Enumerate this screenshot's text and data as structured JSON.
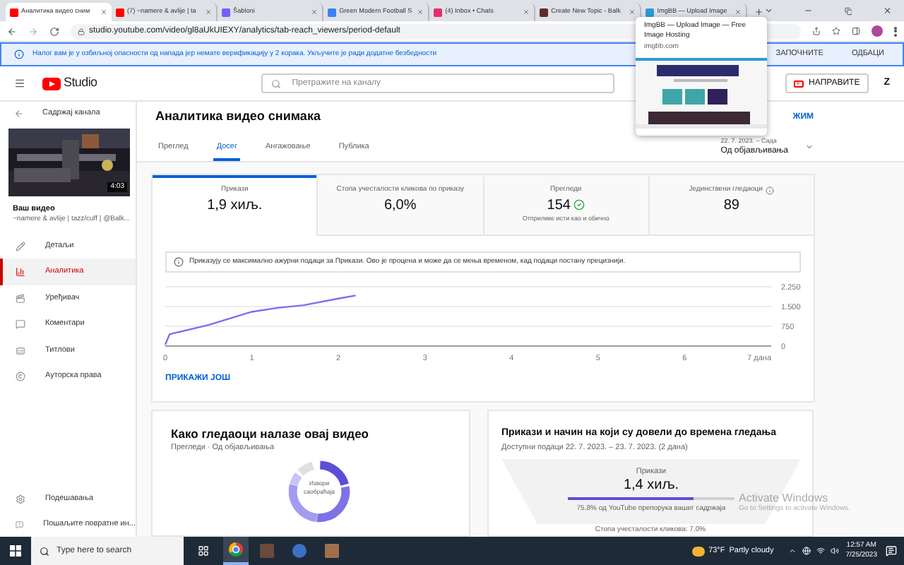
{
  "browser": {
    "tabs": [
      {
        "title": "Аналитика видео сним",
        "selected": true
      },
      {
        "title": "(7) ~namere & avlije | ta",
        "selected": false
      },
      {
        "title": "Šabloni",
        "selected": false
      },
      {
        "title": "Green Modern Football S",
        "selected": false
      },
      {
        "title": "(4) Inbox • Chats",
        "selected": false
      },
      {
        "title": "Create New Topic - Balk",
        "selected": false
      },
      {
        "title": "ImgBB — Upload Image",
        "selected": false
      }
    ],
    "url": "studio.youtube.com/video/gl8aUkUIEXY/analytics/tab-reach_viewers/period-default"
  },
  "tab_preview": {
    "title": "ImgBB — Upload Image — Free Image Hosting",
    "domain": "imgbb.com"
  },
  "banner": {
    "message": "Налог вам је у озбиљној опасности од напада јер немате верификацију у 2 корака. Укључите је ради додатне безбедности",
    "buttons": [
      "ЗАПОЧНИТЕ",
      "ОДБАЦИ"
    ]
  },
  "header": {
    "logo": "Studio",
    "search_placeholder": "Претражите на каналу",
    "create_button": "НАПРАВИТЕ",
    "avatar": "Z"
  },
  "sidebar": {
    "back_label": "Садржај канала",
    "video_duration": "4:03",
    "video_label": "Ваш видео",
    "video_name": "~namere & avlije | tazz/cuff | @Balk...",
    "items": [
      {
        "label": "Детаљи",
        "selected": false
      },
      {
        "label": "Аналитика",
        "selected": true
      },
      {
        "label": "Уређивач",
        "selected": false
      },
      {
        "label": "Коментари",
        "selected": false
      },
      {
        "label": "Титлови",
        "selected": false
      },
      {
        "label": "Ауторска права",
        "selected": false
      }
    ],
    "bottom_items": [
      "Подешавања",
      "Пошаљите повратне ин..."
    ]
  },
  "main": {
    "title": "Аналитика видео снимака",
    "mode_link": "ЖИМ",
    "date_range": "22. 7. 2023. – Сада",
    "period": "Од објављивања",
    "tabs": [
      {
        "label": "Преглед",
        "selected": false
      },
      {
        "label": "Досег",
        "selected": true
      },
      {
        "label": "Ангажовање",
        "selected": false
      },
      {
        "label": "Публика",
        "selected": false
      }
    ],
    "metrics": [
      {
        "label": "Прикази",
        "value": "1,9 хиљ.",
        "selected": true
      },
      {
        "label": "Стопа учесталости кликова по приказу",
        "value": "6,0%",
        "selected": false
      },
      {
        "label": "Прегледи",
        "value": "154",
        "note": "Отприлике исти као и обично",
        "kind": "check",
        "selected": false
      },
      {
        "label": "Јединствени гледаоци",
        "value": "89",
        "kind": "info",
        "selected": false
      }
    ],
    "notice": "Приказују се максимално ажурни подаци за Прикази. Ово је процена и може да се мења временом, кад подаци постану прецизнији.",
    "chart_data": {
      "type": "line",
      "x": [
        0,
        0.05,
        0.5,
        1,
        1.3,
        1.6,
        2,
        2.2
      ],
      "series": [
        {
          "color": "#7b6ff0",
          "values": [
            50,
            450,
            800,
            1300,
            1450,
            1550,
            1800,
            1920
          ]
        }
      ],
      "xlim": [
        0,
        7
      ],
      "ylim": [
        0,
        2250
      ],
      "xticks": [
        0,
        1,
        2,
        3,
        4,
        5,
        6,
        {
          "value": 7,
          "label": "7 дана"
        }
      ],
      "yticks": [
        0,
        {
          "value": 750,
          "label": "750"
        },
        {
          "value": 1500,
          "label": "1.500"
        },
        {
          "value": 2250,
          "label": "2.250"
        }
      ]
    },
    "show_more": "ПРИКАЖИ ЈОШ"
  },
  "cards": [
    {
      "kind": "traffic",
      "title": "Како гледаоци налазе овај видео",
      "subtitle": "Прегледи · Од објављивања",
      "center_label": "Извори саобраћаја"
    },
    {
      "kind": "funnel",
      "title": "Прикази и начин на који су довели до времена гледања",
      "subtitle": "Доступни подаци 22. 7. 2023. – 23. 7. 2023. (2 дана)",
      "metric_label": "Прикази",
      "metric_value": "1,4 хиљ.",
      "level": 0.758,
      "metric_note": "75,8% од YouTube препорука вашег садржаја",
      "next_label": "Стопа учесталости кликова: 7,0%"
    }
  ],
  "activation": {
    "title": "Activate Windows",
    "subtitle": "Go to Settings to activate Windows."
  },
  "taskbar": {
    "search_placeholder": "Type here to search",
    "temperature": "73°F",
    "weather": "Partly cloudy",
    "time": "12:57 AM",
    "date": "7/25/2023"
  }
}
